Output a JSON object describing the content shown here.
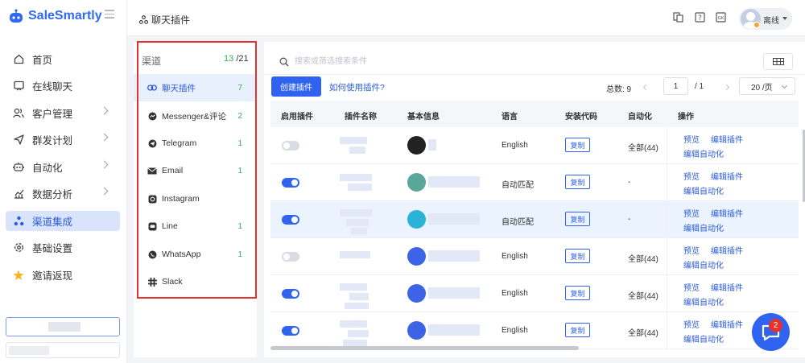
{
  "app": {
    "logo_text": "SaleSmartly"
  },
  "nav": {
    "items": [
      {
        "label": "首页",
        "icon": "home-icon"
      },
      {
        "label": "在线聊天",
        "icon": "chat-icon"
      },
      {
        "label": "客户管理",
        "icon": "users-icon"
      },
      {
        "label": "群发计划",
        "icon": "send-icon"
      },
      {
        "label": "自动化",
        "icon": "robot-icon"
      },
      {
        "label": "数据分析",
        "icon": "chart-icon"
      },
      {
        "label": "渠道集成",
        "icon": "integration-icon"
      },
      {
        "label": "基础设置",
        "icon": "gear-icon"
      },
      {
        "label": "邀请返现",
        "icon": "star-icon"
      }
    ]
  },
  "header": {
    "breadcrumb": "聊天插件",
    "user_status": "离线"
  },
  "channels": {
    "title": "渠道",
    "count_active": "13",
    "count_total": "/21",
    "items": [
      {
        "label": "聊天插件",
        "count": "7",
        "icon": "link-icon"
      },
      {
        "label": "Messenger&评论",
        "count": "2",
        "icon": "messenger-icon"
      },
      {
        "label": "Telegram",
        "count": "1",
        "icon": "telegram-icon"
      },
      {
        "label": "Email",
        "count": "1",
        "icon": "mail-icon"
      },
      {
        "label": "Instagram",
        "count": "",
        "icon": "instagram-icon"
      },
      {
        "label": "Line",
        "count": "1",
        "icon": "line-icon"
      },
      {
        "label": "WhatsApp",
        "count": "1",
        "icon": "whatsapp-icon"
      },
      {
        "label": "Slack",
        "count": "",
        "icon": "slack-icon"
      }
    ]
  },
  "toolbar": {
    "search_placeholder": "搜索或筛选搜索条件",
    "create_label": "创建插件",
    "how_to_label": "如何使用插件?"
  },
  "pagination": {
    "total": "总数: 9",
    "current": "1",
    "of": "/ 1",
    "page_size": "20 /页"
  },
  "table": {
    "headers": [
      "启用插件",
      "插件名称",
      "基本信息",
      "语言",
      "安装代码",
      "自动化",
      "操作"
    ],
    "rows": [
      {
        "enabled": false,
        "language": "English",
        "copy": "复制",
        "automation": "全部(44)",
        "preview": "预览",
        "edit": "编辑插件",
        "edit_auto": "编辑自动化",
        "avatar_color": "#222222"
      },
      {
        "enabled": true,
        "language": "自动匹配",
        "copy": "复制",
        "automation": "-",
        "preview": "预览",
        "edit": "编辑插件",
        "edit_auto": "编辑自动化",
        "avatar_color": "#5aa79a"
      },
      {
        "enabled": true,
        "language": "自动匹配",
        "copy": "复制",
        "automation": "-",
        "preview": "预览",
        "edit": "编辑插件",
        "edit_auto": "编辑自动化",
        "avatar_color": "#2ab3d6"
      },
      {
        "enabled": false,
        "language": "English",
        "copy": "复制",
        "automation": "全部(44)",
        "preview": "预览",
        "edit": "编辑插件",
        "edit_auto": "编辑自动化",
        "avatar_color": "#3d63e6"
      },
      {
        "enabled": true,
        "language": "English",
        "copy": "复制",
        "automation": "全部(44)",
        "preview": "预览",
        "edit": "编辑插件",
        "edit_auto": "编辑自动化",
        "avatar_color": "#3d63e6"
      },
      {
        "enabled": true,
        "language": "English",
        "copy": "复制",
        "automation": "全部(44)",
        "preview": "预览",
        "edit": "编辑插件",
        "edit_auto": "编辑自动化",
        "avatar_color": "#3d63e6"
      }
    ]
  },
  "chat_widget": {
    "badge": "2"
  }
}
